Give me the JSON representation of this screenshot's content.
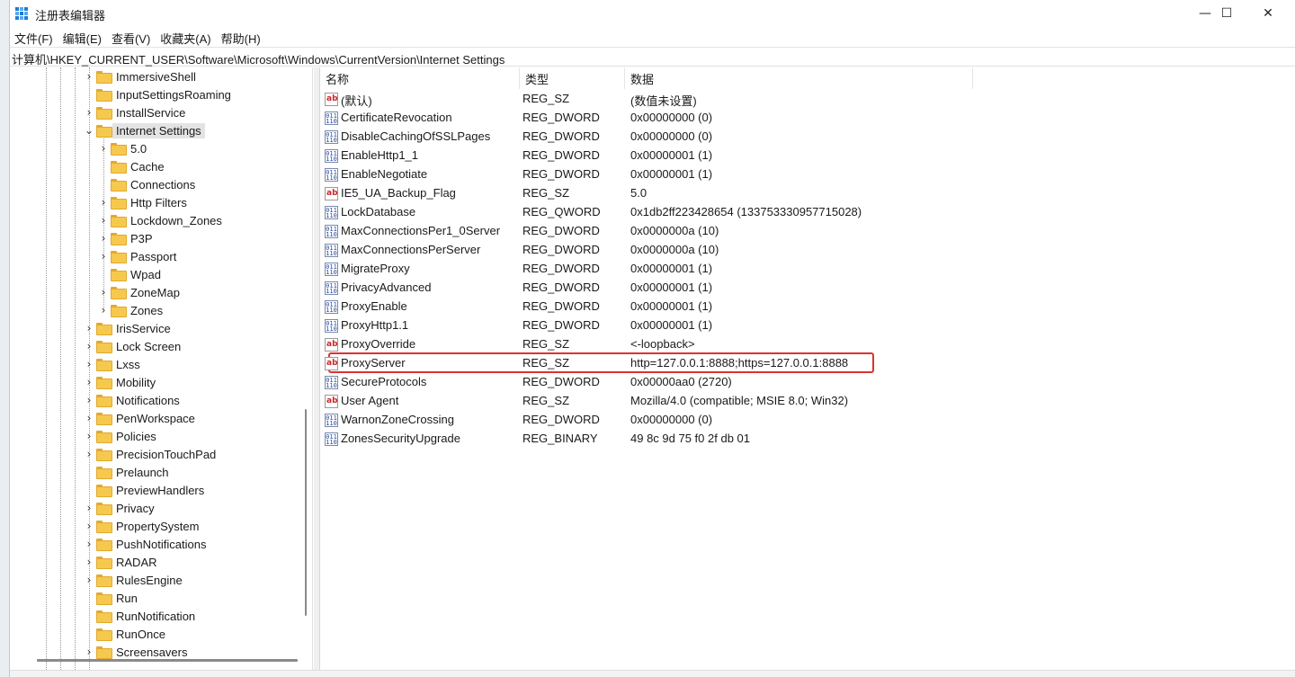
{
  "window": {
    "title": "注册表编辑器",
    "minimize": "—",
    "maximize": "☐",
    "close": "✕"
  },
  "menu": [
    "文件(F)",
    "编辑(E)",
    "查看(V)",
    "收藏夹(A)",
    "帮助(H)"
  ],
  "address": "计算机\\HKEY_CURRENT_USER\\Software\\Microsoft\\Windows\\CurrentVersion\\Internet Settings",
  "tree": [
    {
      "label": "ImmersiveShell",
      "expander": "›",
      "level": 0
    },
    {
      "label": "InputSettingsRoaming",
      "expander": "",
      "level": 0
    },
    {
      "label": "InstallService",
      "expander": "›",
      "level": 0
    },
    {
      "label": "Internet Settings",
      "expander": "⌄",
      "level": 0,
      "selected": true
    },
    {
      "label": "5.0",
      "expander": "›",
      "level": 1
    },
    {
      "label": "Cache",
      "expander": "",
      "level": 1
    },
    {
      "label": "Connections",
      "expander": "",
      "level": 1
    },
    {
      "label": "Http Filters",
      "expander": "›",
      "level": 1
    },
    {
      "label": "Lockdown_Zones",
      "expander": "›",
      "level": 1
    },
    {
      "label": "P3P",
      "expander": "›",
      "level": 1
    },
    {
      "label": "Passport",
      "expander": "›",
      "level": 1
    },
    {
      "label": "Wpad",
      "expander": "",
      "level": 1
    },
    {
      "label": "ZoneMap",
      "expander": "›",
      "level": 1
    },
    {
      "label": "Zones",
      "expander": "›",
      "level": 1
    },
    {
      "label": "IrisService",
      "expander": "›",
      "level": 0
    },
    {
      "label": "Lock Screen",
      "expander": "›",
      "level": 0
    },
    {
      "label": "Lxss",
      "expander": "›",
      "level": 0
    },
    {
      "label": "Mobility",
      "expander": "›",
      "level": 0
    },
    {
      "label": "Notifications",
      "expander": "›",
      "level": 0
    },
    {
      "label": "PenWorkspace",
      "expander": "›",
      "level": 0
    },
    {
      "label": "Policies",
      "expander": "›",
      "level": 0
    },
    {
      "label": "PrecisionTouchPad",
      "expander": "›",
      "level": 0
    },
    {
      "label": "Prelaunch",
      "expander": "",
      "level": 0
    },
    {
      "label": "PreviewHandlers",
      "expander": "",
      "level": 0
    },
    {
      "label": "Privacy",
      "expander": "›",
      "level": 0
    },
    {
      "label": "PropertySystem",
      "expander": "›",
      "level": 0
    },
    {
      "label": "PushNotifications",
      "expander": "›",
      "level": 0
    },
    {
      "label": "RADAR",
      "expander": "›",
      "level": 0
    },
    {
      "label": "RulesEngine",
      "expander": "›",
      "level": 0
    },
    {
      "label": "Run",
      "expander": "",
      "level": 0
    },
    {
      "label": "RunNotification",
      "expander": "",
      "level": 0
    },
    {
      "label": "RunOnce",
      "expander": "",
      "level": 0
    },
    {
      "label": "Screensavers",
      "expander": "›",
      "level": 0
    }
  ],
  "columns": [
    "名称",
    "类型",
    "数据"
  ],
  "values": [
    {
      "name": "(默认)",
      "type": "REG_SZ",
      "data": "(数值未设置)",
      "icon": "string-value-icon"
    },
    {
      "name": "CertificateRevocation",
      "type": "REG_DWORD",
      "data": "0x00000000 (0)",
      "icon": "binary-value-icon"
    },
    {
      "name": "DisableCachingOfSSLPages",
      "type": "REG_DWORD",
      "data": "0x00000000 (0)",
      "icon": "binary-value-icon"
    },
    {
      "name": "EnableHttp1_1",
      "type": "REG_DWORD",
      "data": "0x00000001 (1)",
      "icon": "binary-value-icon"
    },
    {
      "name": "EnableNegotiate",
      "type": "REG_DWORD",
      "data": "0x00000001 (1)",
      "icon": "binary-value-icon"
    },
    {
      "name": "IE5_UA_Backup_Flag",
      "type": "REG_SZ",
      "data": "5.0",
      "icon": "string-value-icon"
    },
    {
      "name": "LockDatabase",
      "type": "REG_QWORD",
      "data": "0x1db2ff223428654 (133753330957715028)",
      "icon": "binary-value-icon"
    },
    {
      "name": "MaxConnectionsPer1_0Server",
      "type": "REG_DWORD",
      "data": "0x0000000a (10)",
      "icon": "binary-value-icon"
    },
    {
      "name": "MaxConnectionsPerServer",
      "type": "REG_DWORD",
      "data": "0x0000000a (10)",
      "icon": "binary-value-icon"
    },
    {
      "name": "MigrateProxy",
      "type": "REG_DWORD",
      "data": "0x00000001 (1)",
      "icon": "binary-value-icon"
    },
    {
      "name": "PrivacyAdvanced",
      "type": "REG_DWORD",
      "data": "0x00000001 (1)",
      "icon": "binary-value-icon"
    },
    {
      "name": "ProxyEnable",
      "type": "REG_DWORD",
      "data": "0x00000001 (1)",
      "icon": "binary-value-icon"
    },
    {
      "name": "ProxyHttp1.1",
      "type": "REG_DWORD",
      "data": "0x00000001 (1)",
      "icon": "binary-value-icon"
    },
    {
      "name": "ProxyOverride",
      "type": "REG_SZ",
      "data": "<-loopback>",
      "icon": "string-value-icon"
    },
    {
      "name": "ProxyServer",
      "type": "REG_SZ",
      "data": "http=127.0.0.1:8888;https=127.0.0.1:8888",
      "icon": "string-value-icon",
      "highlighted": true
    },
    {
      "name": "SecureProtocols",
      "type": "REG_DWORD",
      "data": "0x00000aa0 (2720)",
      "icon": "binary-value-icon"
    },
    {
      "name": "User Agent",
      "type": "REG_SZ",
      "data": "Mozilla/4.0 (compatible; MSIE 8.0; Win32)",
      "icon": "string-value-icon"
    },
    {
      "name": "WarnonZoneCrossing",
      "type": "REG_DWORD",
      "data": "0x00000000 (0)",
      "icon": "binary-value-icon"
    },
    {
      "name": "ZonesSecurityUpgrade",
      "type": "REG_BINARY",
      "data": "49 8c 9d 75 f0 2f db 01",
      "icon": "binary-value-icon"
    }
  ],
  "colors": {
    "highlight_border": "#e03030",
    "folder": "#f6c94e",
    "selected_bg": "#e3e3e3"
  }
}
